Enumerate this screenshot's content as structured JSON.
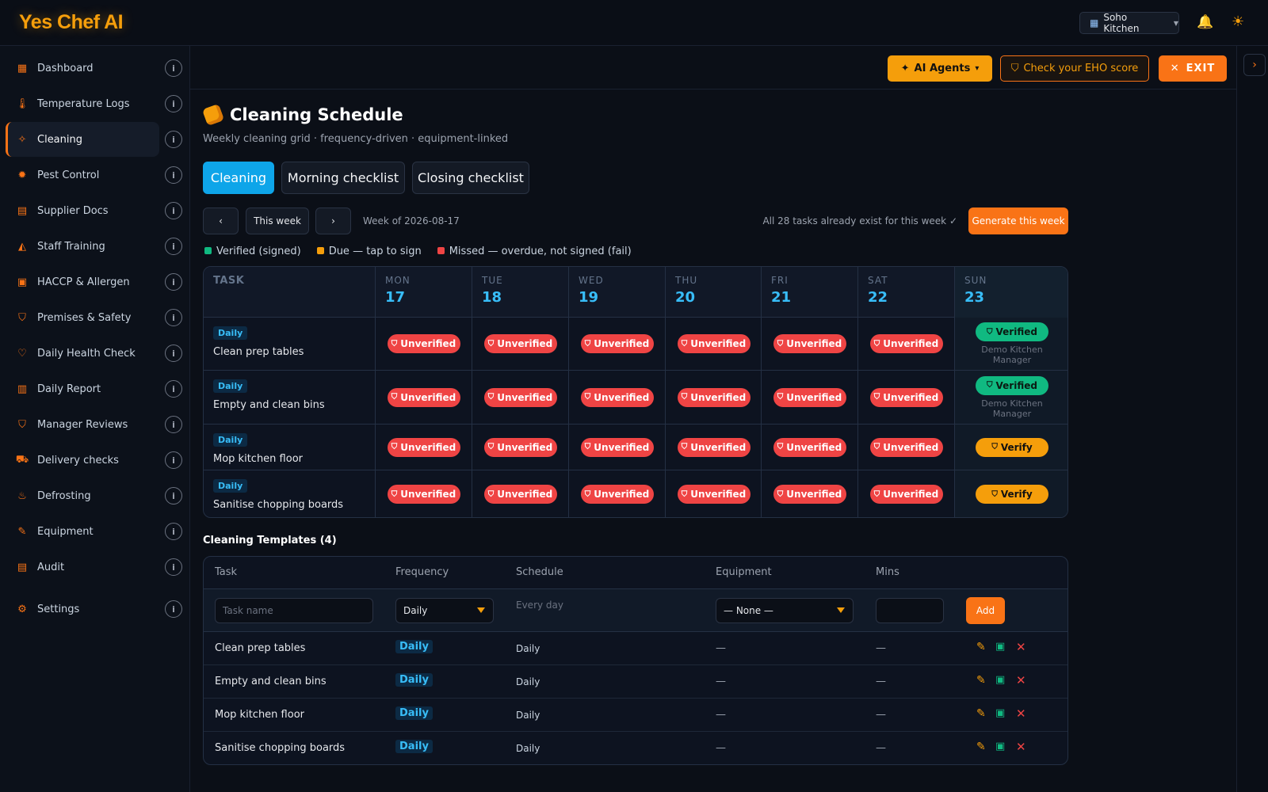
{
  "app": {
    "brand": "Yes Chef AI",
    "kitchen": "Soho Kitchen"
  },
  "sidebar": {
    "items": [
      {
        "label": "Dashboard",
        "icon": "dashboard-icon",
        "glyph": "▦"
      },
      {
        "label": "Temperature Logs",
        "icon": "thermometer-icon",
        "glyph": "🌡"
      },
      {
        "label": "Cleaning",
        "icon": "spray-icon",
        "glyph": "✧"
      },
      {
        "label": "Pest Control",
        "icon": "bug-icon",
        "glyph": "✹"
      },
      {
        "label": "Supplier Docs",
        "icon": "document-icon",
        "glyph": "▤"
      },
      {
        "label": "Staff Training",
        "icon": "graduation-cap-icon",
        "glyph": "◭"
      },
      {
        "label": "HACCP & Allergen",
        "icon": "clipboard-icon",
        "glyph": "▣"
      },
      {
        "label": "Premises & Safety",
        "icon": "shield-icon",
        "glyph": "⛉"
      },
      {
        "label": "Daily Health Check",
        "icon": "heart-icon",
        "glyph": "♡"
      },
      {
        "label": "Daily Report",
        "icon": "report-icon",
        "glyph": "▥"
      },
      {
        "label": "Manager Reviews",
        "icon": "shield-check-icon",
        "glyph": "⛉"
      },
      {
        "label": "Delivery checks",
        "icon": "truck-icon",
        "glyph": "⛟"
      },
      {
        "label": "Defrosting",
        "icon": "flame-icon",
        "glyph": "♨"
      },
      {
        "label": "Equipment",
        "icon": "wrench-icon",
        "glyph": "✎"
      },
      {
        "label": "Audit",
        "icon": "clipboard-list-icon",
        "glyph": "▤"
      },
      {
        "label": "Settings",
        "icon": "gear-icon",
        "glyph": "⚙"
      }
    ],
    "info_glyph": "i"
  },
  "actions": {
    "agents": "AI Agents",
    "eho": "Check your EHO score",
    "exit": "EXIT"
  },
  "page": {
    "title": "Cleaning Schedule",
    "subtitle": "Weekly cleaning grid · frequency-driven · equipment-linked",
    "tabs": [
      "Cleaning",
      "Morning checklist",
      "Closing checklist"
    ]
  },
  "week": {
    "this_week": "This week",
    "label": "Week of 2026-08-17",
    "exist_note": "All 28 tasks already exist for this week ✓",
    "generate": "Generate this week"
  },
  "legend": [
    {
      "label": "Verified (signed)",
      "color": "#10b981"
    },
    {
      "label": "Due — tap to sign",
      "color": "#f59e0b"
    },
    {
      "label": "Missed — overdue, not signed (fail)",
      "color": "#ef4444"
    }
  ],
  "grid": {
    "task_header": "TASK",
    "days": [
      {
        "name": "MON",
        "date": "17"
      },
      {
        "name": "TUE",
        "date": "18"
      },
      {
        "name": "WED",
        "date": "19"
      },
      {
        "name": "THU",
        "date": "20"
      },
      {
        "name": "FRI",
        "date": "21"
      },
      {
        "name": "SAT",
        "date": "22"
      },
      {
        "name": "SUN",
        "date": "23"
      }
    ],
    "rows": [
      {
        "freq": "Daily",
        "task": "Clean prep tables",
        "cells": [
          "Unverified",
          "Unverified",
          "Unverified",
          "Unverified",
          "Unverified",
          "Unverified",
          "Verified"
        ],
        "signer": "Demo Kitchen Manager"
      },
      {
        "freq": "Daily",
        "task": "Empty and clean bins",
        "cells": [
          "Unverified",
          "Unverified",
          "Unverified",
          "Unverified",
          "Unverified",
          "Unverified",
          "Verified"
        ],
        "signer": "Demo Kitchen Manager"
      },
      {
        "freq": "Daily",
        "task": "Mop kitchen floor",
        "cells": [
          "Unverified",
          "Unverified",
          "Unverified",
          "Unverified",
          "Unverified",
          "Unverified",
          "Verify"
        ],
        "signer": ""
      },
      {
        "freq": "Daily",
        "task": "Sanitise chopping boards",
        "cells": [
          "Unverified",
          "Unverified",
          "Unverified",
          "Unverified",
          "Unverified",
          "Unverified",
          "Verify"
        ],
        "signer": ""
      }
    ]
  },
  "templates": {
    "title": "Cleaning Templates (4)",
    "headers": [
      "Task",
      "Frequency",
      "Schedule",
      "Equipment",
      "Mins"
    ],
    "new": {
      "task_placeholder": "Task name",
      "frequency": "Daily",
      "schedule": "Every day",
      "equipment": "— None —",
      "add": "Add"
    },
    "rows": [
      {
        "task": "Clean prep tables",
        "freq": "Daily",
        "schedule": "Daily",
        "equipment": "—",
        "mins": "—"
      },
      {
        "task": "Empty and clean bins",
        "freq": "Daily",
        "schedule": "Daily",
        "equipment": "—",
        "mins": "—"
      },
      {
        "task": "Mop kitchen floor",
        "freq": "Daily",
        "schedule": "Daily",
        "equipment": "—",
        "mins": "—"
      },
      {
        "task": "Sanitise chopping boards",
        "freq": "Daily",
        "schedule": "Daily",
        "equipment": "—",
        "mins": "—"
      }
    ]
  }
}
